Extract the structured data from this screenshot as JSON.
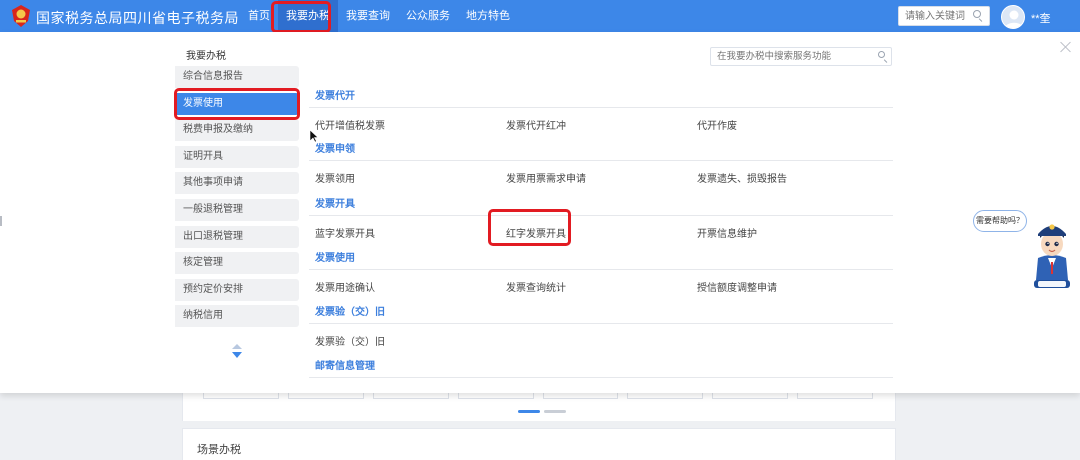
{
  "header": {
    "site_title": "国家税务总局四川省电子税务局",
    "nav": [
      "首页",
      "我要办税",
      "我要查询",
      "公众服务",
      "地方特色"
    ],
    "active_nav": "我要办税",
    "search_placeholder": "请输入关键词",
    "user_name": "**奎",
    "bg_color": "#3d87e8"
  },
  "menu": {
    "title": "我要办税",
    "items": [
      "综合信息报告",
      "发票使用",
      "税费申报及缴纳",
      "证明开具",
      "其他事项申请",
      "一般退税管理",
      "出口退税管理",
      "核定管理",
      "预约定价安排",
      "纳税信用"
    ],
    "active_item": "发票使用"
  },
  "content": {
    "search_placeholder": "在我要办税中搜索服务功能",
    "sections": [
      {
        "title": "发票代开",
        "items": [
          "代开增值税发票",
          "发票代开红冲",
          "代开作废"
        ]
      },
      {
        "title": "发票申领",
        "items": [
          "发票领用",
          "发票用票需求申请",
          "发票遗失、损毁报告"
        ]
      },
      {
        "title": "发票开具",
        "items": [
          "蓝字发票开具",
          "红字发票开具",
          "开票信息维护"
        ]
      },
      {
        "title": "发票使用",
        "items": [
          "发票用途确认",
          "发票查询统计",
          "授信额度调整申请"
        ]
      },
      {
        "title": "发票验（交）旧",
        "items": [
          "发票验（交）旧"
        ]
      },
      {
        "title": "邮寄信息管理",
        "items": []
      }
    ],
    "highlighted_item": "红字发票开具"
  },
  "helper": {
    "bubble": "需要帮助吗？"
  },
  "page_bg": {
    "card_title": "场景办税"
  },
  "colors": {
    "accent": "#3d87e8",
    "highlight_box": "#e21b22",
    "section_title": "#3d7fdd"
  }
}
